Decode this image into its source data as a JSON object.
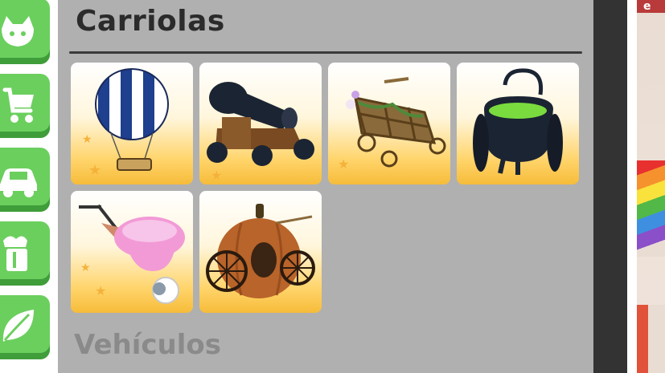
{
  "sidebar": {
    "items": [
      {
        "icon": "pet-icon"
      },
      {
        "icon": "stroller-icon"
      },
      {
        "icon": "car-icon"
      },
      {
        "icon": "food-icon"
      },
      {
        "icon": "leaf-icon"
      }
    ]
  },
  "section": {
    "title": "Carriolas",
    "items": [
      {
        "icon": "hot-air-balloon-stroller-icon"
      },
      {
        "icon": "cannon-stroller-icon"
      },
      {
        "icon": "vine-wagon-stroller-icon"
      },
      {
        "icon": "cauldron-stroller-icon"
      },
      {
        "icon": "vacuum-stroller-icon"
      },
      {
        "icon": "pumpkin-carriage-stroller-icon"
      }
    ]
  },
  "next_section": {
    "title": "Vehículos"
  },
  "right_banner": {
    "text": "e"
  },
  "colors": {
    "panel": "#b0b0b0",
    "button_green": "#6bcf5e",
    "card_gradient_bottom": "#f6bc3a",
    "scrollbar": "#333333"
  }
}
